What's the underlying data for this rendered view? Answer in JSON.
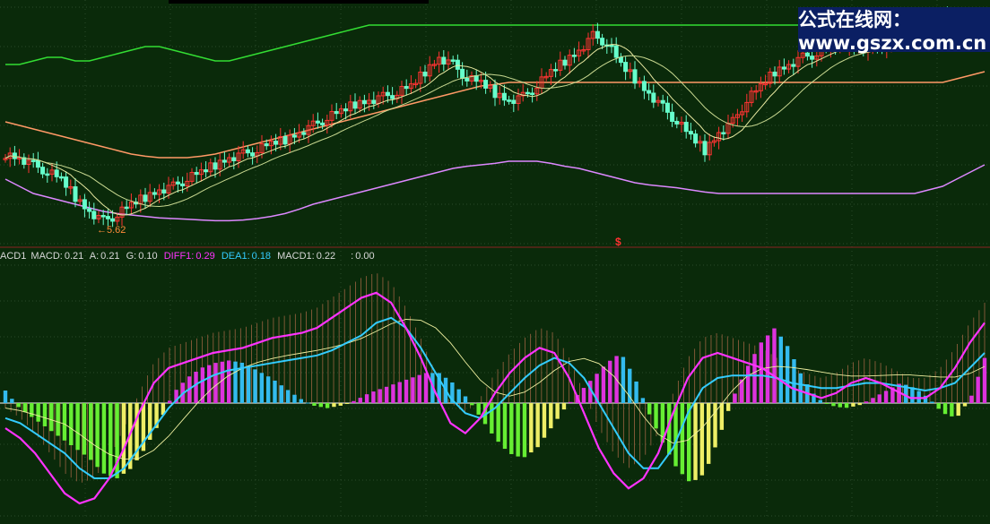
{
  "watermark": "公式在线网：www.gszx.com.cn",
  "price_low_label": "5.62",
  "signal_mark": "$",
  "legend": {
    "title": "ACD1",
    "items": [
      {
        "label": "MACD:",
        "value": "0.21",
        "color": "#d8d8d8"
      },
      {
        "label": "A:",
        "value": "0.21",
        "color": "#d8d8d8"
      },
      {
        "label": "G:",
        "value": "0.10",
        "color": "#d8d8d8"
      },
      {
        "label": "DIFF1:",
        "value": "0.29",
        "color": "#ff33ff"
      },
      {
        "label": "DEA1:",
        "value": "0.18",
        "color": "#33ccff"
      },
      {
        "label": "MACD1:",
        "value": "0.22",
        "color": "#d8d8d8"
      },
      {
        "label": ":",
        "value": "0.00",
        "color": "#d8d8d8"
      }
    ]
  },
  "colors": {
    "background": "#0a2a0a",
    "grid": "#2a4a2a",
    "up_candle": "#ff3333",
    "down_candle": "#66ffcc",
    "upper_band": "#33dd33",
    "mid_band": "#ff9966",
    "lower_band": "#dd88ff",
    "diff": "#ff33ff",
    "dea": "#33ccff",
    "macd_hist_pos": "#dd33dd",
    "macd_hist_pos_alt": "#33bbee",
    "macd_hist_neg": "#66ee33",
    "macd_hist_neg_alt": "#eeee66",
    "area_fill": "#cc7755"
  },
  "chart_data": [
    {
      "type": "line",
      "panel": "price",
      "title": "",
      "series": [
        {
          "name": "",
          "role": "close",
          "values": [
            6.55,
            6.5,
            6.4,
            6.3,
            6.2,
            5.95,
            5.75,
            5.62,
            5.7,
            5.85,
            5.95,
            6.05,
            6.1,
            6.2,
            6.3,
            6.4,
            6.5,
            6.55,
            6.6,
            6.7,
            6.75,
            6.85,
            6.95,
            7.05,
            7.15,
            7.25,
            7.3,
            7.35,
            7.4,
            7.5,
            7.7,
            7.9,
            7.8,
            7.6,
            7.55,
            7.4,
            7.3,
            7.35,
            7.5,
            7.7,
            7.85,
            8.0,
            8.2,
            8.1,
            7.8,
            7.6,
            7.4,
            7.2,
            7.0,
            6.8,
            6.6,
            6.85,
            7.0,
            7.3,
            7.5,
            7.7,
            7.8,
            7.9,
            7.95,
            8.05,
            8.1,
            8.05,
            8.0,
            8.1,
            8.15,
            8.2,
            8.3,
            8.45,
            8.4,
            8.3,
            8.35
          ]
        },
        {
          "name": "",
          "role": "upper",
          "values": [
            7.8,
            7.8,
            7.85,
            7.9,
            7.9,
            7.85,
            7.85,
            7.9,
            7.95,
            8.0,
            8.05,
            8.05,
            8.0,
            7.95,
            7.9,
            7.85,
            7.85,
            7.9,
            7.95,
            8.0,
            8.05,
            8.1,
            8.15,
            8.2,
            8.25,
            8.3,
            8.35,
            8.35,
            8.35,
            8.35,
            8.35,
            8.35,
            8.35,
            8.35,
            8.35,
            8.35,
            8.35,
            8.35,
            8.35,
            8.35,
            8.35,
            8.35,
            8.35,
            8.35,
            8.35,
            8.35,
            8.35,
            8.35,
            8.35,
            8.35,
            8.35,
            8.35,
            8.35,
            8.35,
            8.35,
            8.35,
            8.35,
            8.35,
            8.35,
            8.35,
            8.35,
            8.35,
            8.35,
            8.35,
            8.35,
            8.35,
            8.35,
            8.35,
            8.35,
            8.35,
            8.35
          ]
        },
        {
          "name": "",
          "role": "middle",
          "values": [
            7.0,
            6.95,
            6.9,
            6.85,
            6.8,
            6.75,
            6.7,
            6.65,
            6.6,
            6.55,
            6.52,
            6.5,
            6.5,
            6.5,
            6.52,
            6.55,
            6.6,
            6.65,
            6.7,
            6.75,
            6.8,
            6.85,
            6.9,
            6.95,
            7.0,
            7.05,
            7.1,
            7.15,
            7.2,
            7.25,
            7.3,
            7.35,
            7.4,
            7.45,
            7.5,
            7.52,
            7.55,
            7.55,
            7.55,
            7.55,
            7.55,
            7.55,
            7.55,
            7.55,
            7.55,
            7.55,
            7.55,
            7.55,
            7.55,
            7.55,
            7.55,
            7.55,
            7.55,
            7.55,
            7.55,
            7.55,
            7.55,
            7.55,
            7.55,
            7.55,
            7.55,
            7.55,
            7.55,
            7.55,
            7.55,
            7.55,
            7.55,
            7.55,
            7.6,
            7.65,
            7.7
          ]
        },
        {
          "name": "",
          "role": "lower",
          "values": [
            6.2,
            6.1,
            6.0,
            5.95,
            5.9,
            5.85,
            5.8,
            5.75,
            5.72,
            5.7,
            5.68,
            5.66,
            5.65,
            5.64,
            5.63,
            5.62,
            5.62,
            5.63,
            5.65,
            5.68,
            5.72,
            5.78,
            5.85,
            5.9,
            5.95,
            6.0,
            6.05,
            6.1,
            6.15,
            6.2,
            6.25,
            6.3,
            6.35,
            6.38,
            6.4,
            6.42,
            6.45,
            6.45,
            6.45,
            6.42,
            6.38,
            6.35,
            6.3,
            6.25,
            6.2,
            6.15,
            6.12,
            6.1,
            6.08,
            6.05,
            6.02,
            6.0,
            6.0,
            6.0,
            6.0,
            6.0,
            6.0,
            6.0,
            6.0,
            6.0,
            6.0,
            6.0,
            6.0,
            6.0,
            6.0,
            6.0,
            6.05,
            6.1,
            6.2,
            6.3,
            6.4
          ]
        }
      ],
      "ylim": [
        5.3,
        8.6
      ]
    },
    {
      "type": "bar",
      "panel": "indicator",
      "title": "",
      "series": [
        {
          "name": "MACD",
          "values": [
            0.05,
            -0.02,
            -0.06,
            -0.1,
            -0.14,
            -0.18,
            -0.22,
            -0.28,
            -0.3,
            -0.26,
            -0.18,
            -0.08,
            0.04,
            0.1,
            0.14,
            0.16,
            0.17,
            0.16,
            0.13,
            0.1,
            0.06,
            0.02,
            -0.01,
            -0.02,
            -0.01,
            0.01,
            0.04,
            0.06,
            0.08,
            0.1,
            0.12,
            0.12,
            0.08,
            0.02,
            -0.06,
            -0.14,
            -0.2,
            -0.22,
            -0.18,
            -0.1,
            -0.02,
            0.04,
            0.1,
            0.16,
            0.2,
            0.1,
            -0.04,
            -0.16,
            -0.26,
            -0.32,
            -0.28,
            -0.14,
            0.02,
            0.14,
            0.24,
            0.3,
            0.22,
            0.1,
            0.02,
            -0.01,
            -0.02,
            -0.01,
            0.02,
            0.05,
            0.08,
            0.06,
            0.02,
            -0.04,
            -0.06,
            0.02,
            0.18
          ]
        },
        {
          "name": "DIFF1",
          "values": [
            -0.1,
            -0.14,
            -0.2,
            -0.28,
            -0.36,
            -0.4,
            -0.38,
            -0.3,
            -0.18,
            -0.04,
            0.08,
            0.14,
            0.16,
            0.18,
            0.2,
            0.21,
            0.22,
            0.24,
            0.26,
            0.27,
            0.28,
            0.3,
            0.34,
            0.38,
            0.42,
            0.44,
            0.4,
            0.3,
            0.18,
            0.04,
            -0.08,
            -0.12,
            -0.06,
            0.04,
            0.12,
            0.18,
            0.22,
            0.2,
            0.1,
            -0.04,
            -0.18,
            -0.28,
            -0.34,
            -0.3,
            -0.2,
            -0.04,
            0.1,
            0.18,
            0.2,
            0.18,
            0.16,
            0.14,
            0.1,
            0.06,
            0.04,
            0.02,
            0.04,
            0.08,
            0.1,
            0.08,
            0.05,
            0.02,
            0.02,
            0.06,
            0.14,
            0.24,
            0.32
          ]
        },
        {
          "name": "DEA1",
          "values": [
            -0.06,
            -0.08,
            -0.12,
            -0.16,
            -0.2,
            -0.26,
            -0.3,
            -0.3,
            -0.26,
            -0.18,
            -0.1,
            -0.02,
            0.04,
            0.08,
            0.11,
            0.13,
            0.14,
            0.15,
            0.16,
            0.17,
            0.18,
            0.19,
            0.21,
            0.24,
            0.27,
            0.32,
            0.34,
            0.3,
            0.22,
            0.12,
            0.02,
            -0.04,
            -0.06,
            -0.02,
            0.04,
            0.1,
            0.15,
            0.18,
            0.16,
            0.1,
            0.0,
            -0.1,
            -0.2,
            -0.26,
            -0.26,
            -0.18,
            -0.04,
            0.06,
            0.1,
            0.11,
            0.11,
            0.11,
            0.1,
            0.08,
            0.07,
            0.06,
            0.06,
            0.07,
            0.08,
            0.08,
            0.07,
            0.06,
            0.05,
            0.06,
            0.08,
            0.14,
            0.2
          ]
        }
      ],
      "ylim": [
        -0.45,
        0.55
      ]
    }
  ]
}
